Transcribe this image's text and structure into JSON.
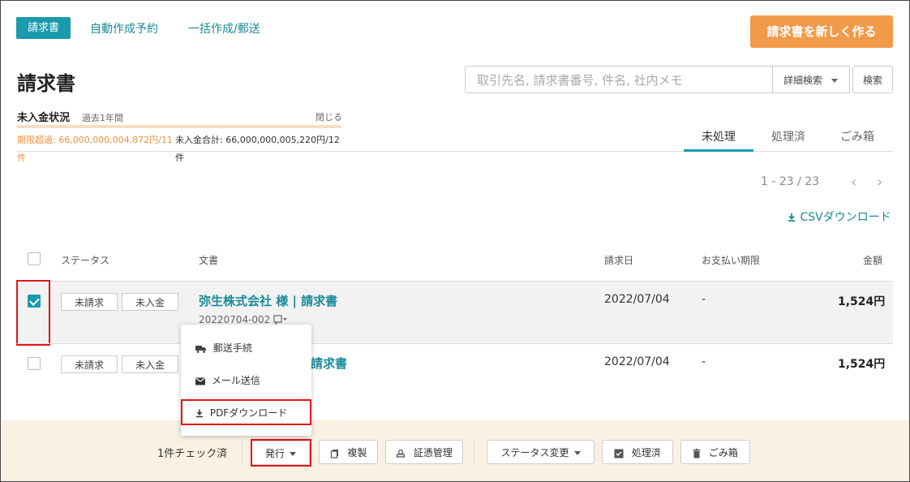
{
  "nav": {
    "tabs": [
      "請求書",
      "自動作成予約",
      "一括作成/郵送"
    ],
    "create_button": "請求書を新しく作る"
  },
  "page": {
    "title": "請求書"
  },
  "search": {
    "placeholder": "取引先名, 請求書番号, 件名, 社内メモ",
    "advanced_label": "詳細検索",
    "button_label": "検索"
  },
  "unpaid": {
    "title": "未入金状況",
    "subtitle": "過去1年間",
    "close_label": "閉じる",
    "overdue_text": "期限超過: 66,000,000,004,872円/11件",
    "total_text": "未入金合計: 66,000,000,005,220円/12件"
  },
  "status_tabs": [
    "未処理",
    "処理済",
    "ごみ箱"
  ],
  "pagination": {
    "range": "1 - 23 / 23"
  },
  "csv_label": "CSVダウンロード",
  "table": {
    "headers": [
      "ステータス",
      "文書",
      "請求日",
      "お支払い期限",
      "金額"
    ],
    "rows": [
      {
        "checked": true,
        "status1": "未請求",
        "status2": "未入金",
        "title": "弥生株式会社 様 | 請求書",
        "number": "20220704-002",
        "date": "2022/07/04",
        "due": "-",
        "amount": "1,524円"
      },
      {
        "checked": false,
        "status1": "未請求",
        "status2": "未入金",
        "title": "請求書",
        "date": "2022/07/04",
        "due": "-",
        "amount": "1,524円"
      }
    ]
  },
  "dropdown": {
    "items": [
      "郵送手続",
      "メール送信",
      "PDFダウンロード"
    ]
  },
  "footer": {
    "checked_count": "1件チェック済",
    "issue": "発行",
    "copy": "複製",
    "evidence": "証憑管理",
    "status_change": "ステータス変更",
    "processed": "処理済",
    "trash": "ごみ箱"
  },
  "colors": {
    "accent": "#1a9aad",
    "orange": "#f19a4a",
    "highlight": "#e0161e"
  }
}
